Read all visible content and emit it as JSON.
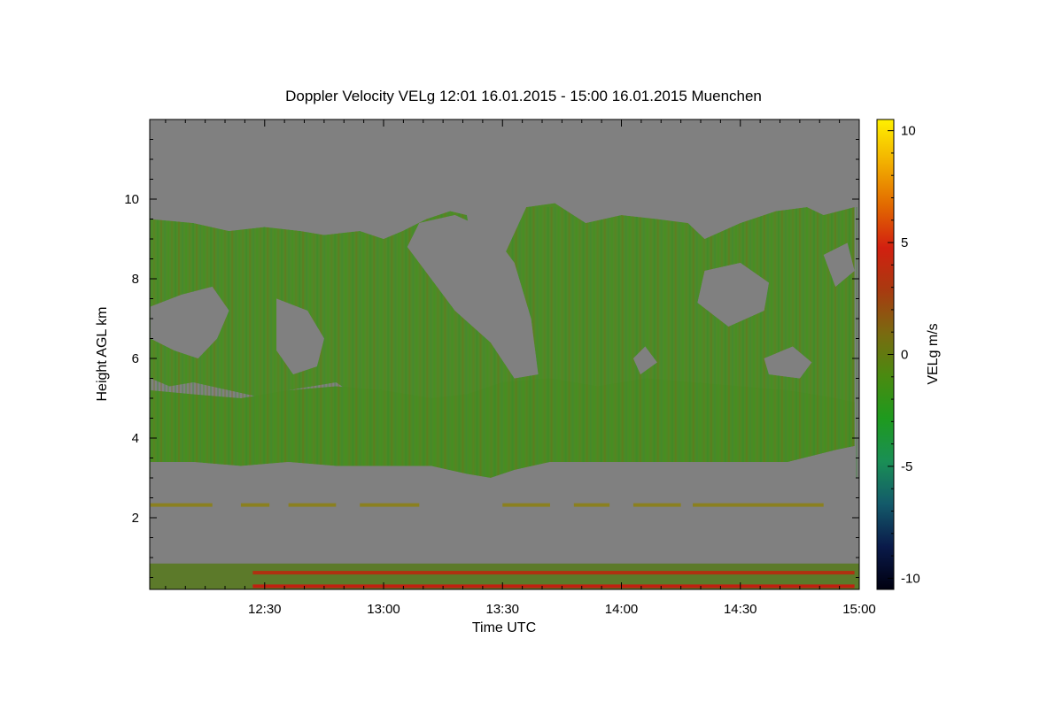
{
  "chart_data": {
    "type": "heatmap",
    "title": "Doppler Velocity VELg   12:01 16.01.2015 - 15:00 16.01.2015 Muenchen",
    "xlabel": "Time UTC",
    "ylabel": "Height AGL km",
    "colorbar_label": "VELg m/s",
    "x_range": [
      "12:01",
      "15:00"
    ],
    "x_ticks": [
      "12:30",
      "13:00",
      "13:30",
      "14:00",
      "14:30",
      "15:00"
    ],
    "y_range": [
      0.2,
      12.0
    ],
    "y_ticks": [
      "2",
      "4",
      "6",
      "8",
      "10"
    ],
    "colorbar_range": [
      -10.5,
      10.5
    ],
    "colorbar_ticks": [
      "10",
      "5",
      "0",
      "-5",
      "-10"
    ],
    "background_value_color": "#808080",
    "colormap": [
      "#000010",
      "#0a1a4a",
      "#135a6a",
      "#1a8f55",
      "#1e9a1e",
      "#4a8a10",
      "#7a6a10",
      "#a83a10",
      "#d22010",
      "#e26a00",
      "#f2b000",
      "#fff000"
    ],
    "cloud_layers": [
      {
        "name": "upper cloud",
        "color": "#4f8a28",
        "top": [
          [
            12.02,
            9.5
          ],
          [
            12.2,
            9.4
          ],
          [
            12.35,
            9.2
          ],
          [
            12.5,
            9.3
          ],
          [
            12.65,
            9.2
          ],
          [
            12.75,
            9.1
          ],
          [
            12.9,
            9.2
          ],
          [
            13.0,
            9.0
          ],
          [
            13.08,
            9.2
          ],
          [
            13.18,
            9.5
          ],
          [
            13.28,
            9.7
          ],
          [
            13.35,
            9.6
          ],
          [
            13.4,
            8.0
          ],
          [
            13.5,
            8.5
          ],
          [
            13.6,
            9.8
          ],
          [
            13.72,
            9.9
          ],
          [
            13.85,
            9.4
          ],
          [
            14.0,
            9.6
          ],
          [
            14.15,
            9.5
          ],
          [
            14.28,
            9.4
          ],
          [
            14.35,
            9.0
          ],
          [
            14.5,
            9.4
          ],
          [
            14.65,
            9.7
          ],
          [
            14.78,
            9.8
          ],
          [
            14.85,
            9.6
          ],
          [
            14.98,
            9.8
          ]
        ],
        "base": [
          [
            12.02,
            5.5
          ],
          [
            12.1,
            5.3
          ],
          [
            12.2,
            5.4
          ],
          [
            12.35,
            5.2
          ],
          [
            12.5,
            5.0
          ],
          [
            12.6,
            5.2
          ],
          [
            12.7,
            5.3
          ],
          [
            12.8,
            5.4
          ],
          [
            12.9,
            5.0
          ],
          [
            13.0,
            4.8
          ],
          [
            13.1,
            4.6
          ],
          [
            13.2,
            4.4
          ],
          [
            13.25,
            4.0
          ],
          [
            13.32,
            3.5
          ],
          [
            13.38,
            3.4
          ],
          [
            13.42,
            3.2
          ],
          [
            13.48,
            3.4
          ],
          [
            13.55,
            3.6
          ],
          [
            13.65,
            3.6
          ],
          [
            13.8,
            3.8
          ],
          [
            13.95,
            3.8
          ],
          [
            14.1,
            3.7
          ],
          [
            14.25,
            3.7
          ],
          [
            14.4,
            3.6
          ],
          [
            14.55,
            3.5
          ],
          [
            14.7,
            3.6
          ],
          [
            14.85,
            3.7
          ],
          [
            14.98,
            3.8
          ]
        ]
      },
      {
        "name": "lower cloud",
        "color": "#4c8a24",
        "top": [
          [
            12.02,
            5.2
          ],
          [
            12.2,
            5.1
          ],
          [
            12.4,
            5.0
          ],
          [
            12.6,
            5.2
          ],
          [
            12.8,
            5.3
          ],
          [
            13.0,
            5.2
          ],
          [
            13.2,
            5.0
          ],
          [
            13.35,
            5.1
          ],
          [
            13.5,
            5.4
          ],
          [
            13.7,
            5.5
          ],
          [
            13.9,
            5.3
          ],
          [
            14.1,
            5.5
          ],
          [
            14.3,
            5.4
          ],
          [
            14.5,
            5.3
          ],
          [
            14.7,
            5.2
          ],
          [
            14.9,
            5.0
          ],
          [
            14.98,
            4.9
          ]
        ],
        "base": [
          [
            12.02,
            3.4
          ],
          [
            12.2,
            3.4
          ],
          [
            12.4,
            3.3
          ],
          [
            12.6,
            3.4
          ],
          [
            12.8,
            3.3
          ],
          [
            13.0,
            3.3
          ],
          [
            13.2,
            3.3
          ],
          [
            13.35,
            3.1
          ],
          [
            13.45,
            3.0
          ],
          [
            13.55,
            3.2
          ],
          [
            13.7,
            3.4
          ],
          [
            13.9,
            3.4
          ],
          [
            14.1,
            3.4
          ],
          [
            14.3,
            3.4
          ],
          [
            14.5,
            3.4
          ],
          [
            14.7,
            3.4
          ],
          [
            14.9,
            3.7
          ],
          [
            14.98,
            3.8
          ]
        ]
      }
    ],
    "clear_gaps": [
      {
        "name": "gap 1",
        "outline": [
          [
            12.02,
            7.3
          ],
          [
            12.15,
            7.6
          ],
          [
            12.28,
            7.8
          ],
          [
            12.35,
            7.2
          ],
          [
            12.3,
            6.5
          ],
          [
            12.22,
            6.0
          ],
          [
            12.12,
            6.2
          ],
          [
            12.02,
            6.5
          ]
        ]
      },
      {
        "name": "gap 2",
        "outline": [
          [
            12.55,
            7.5
          ],
          [
            12.68,
            7.2
          ],
          [
            12.75,
            6.5
          ],
          [
            12.72,
            5.8
          ],
          [
            12.62,
            5.6
          ],
          [
            12.55,
            6.2
          ]
        ]
      },
      {
        "name": "gap 3",
        "outline": [
          [
            13.1,
            8.8
          ],
          [
            13.2,
            8.0
          ],
          [
            13.3,
            7.2
          ],
          [
            13.45,
            6.4
          ],
          [
            13.55,
            5.5
          ],
          [
            13.65,
            5.6
          ],
          [
            13.62,
            7.0
          ],
          [
            13.55,
            8.4
          ],
          [
            13.45,
            9.2
          ],
          [
            13.3,
            9.6
          ],
          [
            13.15,
            9.4
          ]
        ]
      },
      {
        "name": "gap 4",
        "outline": [
          [
            14.05,
            6.0
          ],
          [
            14.1,
            6.3
          ],
          [
            14.15,
            5.9
          ],
          [
            14.08,
            5.6
          ]
        ]
      },
      {
        "name": "gap 5",
        "outline": [
          [
            14.35,
            8.2
          ],
          [
            14.5,
            8.4
          ],
          [
            14.62,
            7.9
          ],
          [
            14.6,
            7.2
          ],
          [
            14.45,
            6.8
          ],
          [
            14.32,
            7.4
          ]
        ]
      },
      {
        "name": "gap 6",
        "outline": [
          [
            14.6,
            6.0
          ],
          [
            14.72,
            6.3
          ],
          [
            14.8,
            5.9
          ],
          [
            14.75,
            5.5
          ],
          [
            14.62,
            5.6
          ]
        ]
      },
      {
        "name": "gap 7",
        "outline": [
          [
            14.85,
            8.6
          ],
          [
            14.95,
            8.9
          ],
          [
            14.98,
            8.2
          ],
          [
            14.9,
            7.8
          ]
        ]
      }
    ],
    "boundary_layer": {
      "top_km": 0.85,
      "base_km": 0.2,
      "color": "#5c7a2a"
    },
    "bands": [
      {
        "y": 2.32,
        "color": "#8a8020",
        "segments": [
          [
            12.02,
            12.28
          ],
          [
            12.4,
            12.52
          ],
          [
            12.6,
            12.8
          ],
          [
            12.9,
            13.15
          ],
          [
            13.5,
            13.7
          ],
          [
            13.8,
            13.95
          ],
          [
            14.05,
            14.25
          ],
          [
            14.3,
            14.85
          ]
        ]
      },
      {
        "y": 0.62,
        "color": "#b03010",
        "segments": [
          [
            12.45,
            14.98
          ]
        ]
      },
      {
        "y": 0.28,
        "color": "#c02010",
        "segments": [
          [
            12.45,
            14.98
          ]
        ]
      }
    ]
  }
}
